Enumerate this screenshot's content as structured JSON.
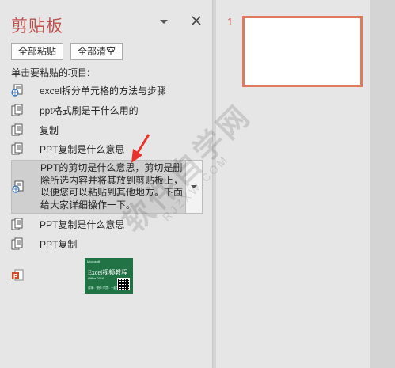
{
  "pane": {
    "title": "剪贴板",
    "paste_all_label": "全部粘贴",
    "clear_all_label": "全部清空",
    "hint": "单击要粘贴的项目:"
  },
  "items": [
    {
      "icon": "web-document-icon",
      "text": "excel拆分单元格的方法与步骤"
    },
    {
      "icon": "document-icon",
      "text": "ppt格式刷是干什么用的"
    },
    {
      "icon": "document-icon",
      "text": "复制"
    },
    {
      "icon": "document-icon",
      "text": "PPT复制是什么意思"
    },
    {
      "icon": "web-document-icon",
      "text": "PPT的剪切是什么意思，剪切是删除所选内容并将其放到剪贴板上，以便您可以粘贴到其他地方。下面给大家详细操作一下。"
    },
    {
      "icon": "document-icon",
      "text": "PPT复制是什么意思"
    },
    {
      "icon": "document-icon",
      "text": "PPT复制"
    }
  ],
  "image_item": {
    "icon": "powerpoint-icon",
    "thumb_brand": "Microsoft",
    "thumb_title": "Excel视频教程",
    "thumb_sub": "Office 2016",
    "thumb_foot": "讲师：帮你  学员：一起学习"
  },
  "slides": [
    {
      "number": "1"
    }
  ],
  "watermark": {
    "big": "软件自学网",
    "small": "RJZXW.COM"
  },
  "colors": {
    "accent": "#c0504d",
    "slide_border": "#e07a5f",
    "arrow": "#e8332a"
  }
}
